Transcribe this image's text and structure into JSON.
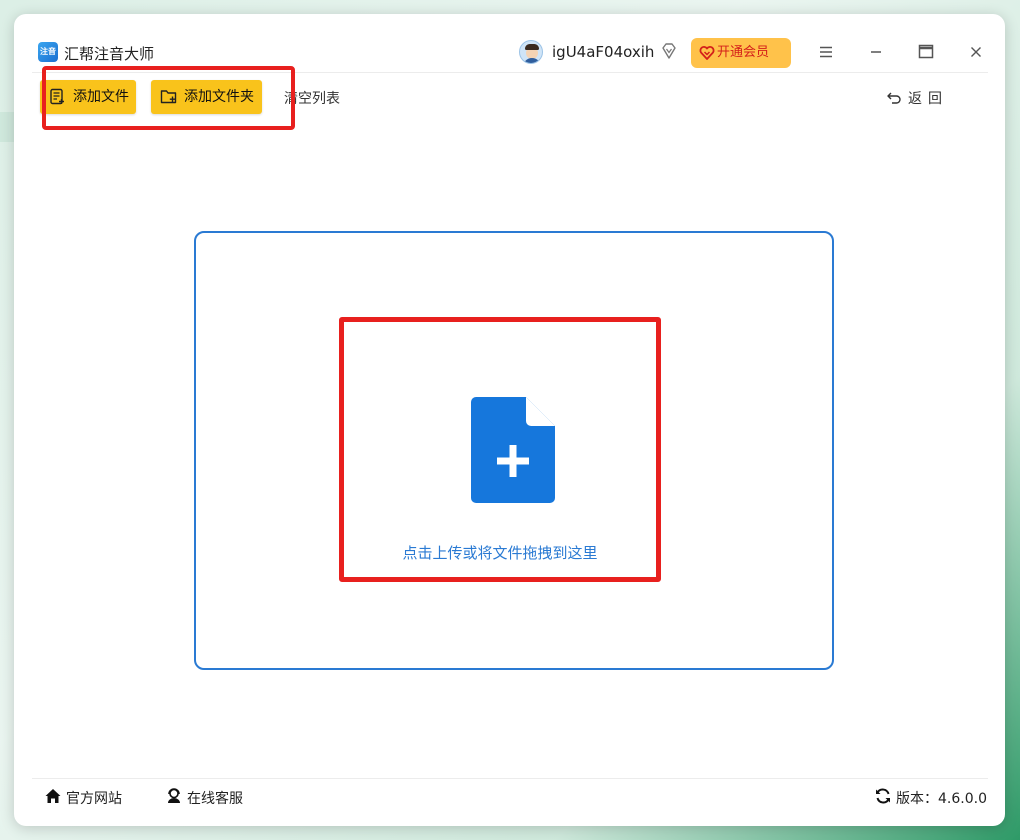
{
  "window": {
    "title": "汇帮注音大师",
    "logo_text": "注音"
  },
  "user": {
    "name": "igU4aF04oxih"
  },
  "vip_button": {
    "label": "开通会员"
  },
  "toolbar": {
    "add_file": "添加文件",
    "add_folder": "添加文件夹",
    "clear_list": "清空列表",
    "back": "返回"
  },
  "upload": {
    "hint": "点击上传或将文件拖拽到这里"
  },
  "footer": {
    "website": "官方网站",
    "support": "在线客服",
    "version": "版本：4.6.0.0"
  },
  "colors": {
    "accent_blue": "#2a7ad3",
    "toolbar_yellow": "#f9c31b",
    "vip_orange": "#ffc24a",
    "highlight_red": "#e8201e"
  }
}
